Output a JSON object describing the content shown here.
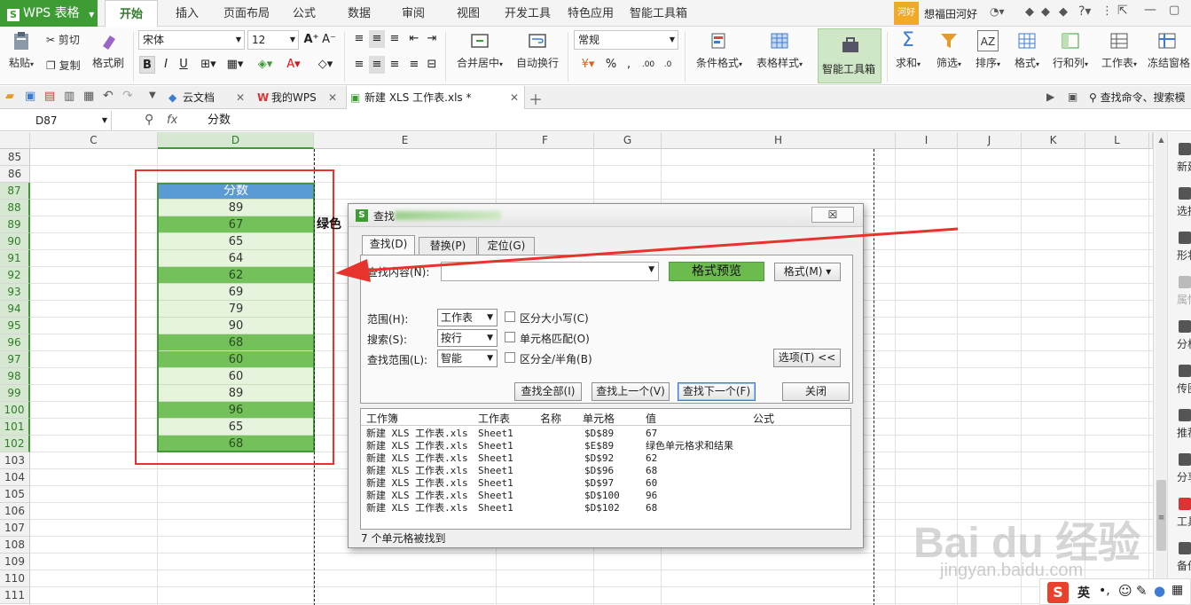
{
  "app": {
    "wps_label": "WPS 表格"
  },
  "menu": {
    "tabs": [
      "开始",
      "插入",
      "页面布局",
      "公式",
      "数据",
      "审阅",
      "视图",
      "开发工具",
      "特色应用",
      "智能工具箱"
    ],
    "active": "开始"
  },
  "user": {
    "avatar": "河好",
    "name": "想福田河好"
  },
  "ribbon": {
    "paste": "粘贴",
    "cut": "剪切",
    "copy": "复制",
    "format_painter": "格式刷",
    "font_name": "宋体",
    "font_size": "12",
    "bold": "B",
    "italic": "I",
    "underline": "U",
    "merge_center": "合并居中",
    "wrap_text": "自动换行",
    "number_format": "常规",
    "percent": "%",
    "comma": "‚",
    "cond_format": "条件格式",
    "table_style": "表格样式",
    "smart_toolbox": "智能工具箱",
    "sum": "求和",
    "filter": "筛选",
    "sort": "排序",
    "format": "格式",
    "row_col": "行和列",
    "worksheet": "工作表",
    "freeze": "冻结窗格"
  },
  "doc_tabs": {
    "cloud": "云文档",
    "mywps": "我的WPS",
    "file": "新建 XLS 工作表.xls *",
    "search_cmd": "查找命令、搜索模"
  },
  "formula_bar": {
    "cell_ref": "D87",
    "fx": "fx",
    "content": "分数"
  },
  "grid": {
    "columns": [
      "C",
      "D",
      "E",
      "F",
      "G",
      "H",
      "I",
      "J",
      "K",
      "L"
    ],
    "selected_column": "D",
    "rows": [
      "85",
      "86",
      "87",
      "88",
      "89",
      "90",
      "91",
      "92",
      "93",
      "94",
      "95",
      "96",
      "97",
      "98",
      "99",
      "100",
      "101",
      "102",
      "103",
      "104",
      "105",
      "106",
      "107",
      "108",
      "109",
      "110",
      "111"
    ],
    "header_label": "分数",
    "scores": [
      {
        "v": "89",
        "style": "light"
      },
      {
        "v": "67",
        "style": "dark"
      },
      {
        "v": "65",
        "style": "light"
      },
      {
        "v": "64",
        "style": "light"
      },
      {
        "v": "62",
        "style": "dark"
      },
      {
        "v": "69",
        "style": "light"
      },
      {
        "v": "79",
        "style": "light"
      },
      {
        "v": "90",
        "style": "light"
      },
      {
        "v": "68",
        "style": "dark"
      },
      {
        "v": "60",
        "style": "dark"
      },
      {
        "v": "60",
        "style": "light"
      },
      {
        "v": "89",
        "style": "light"
      },
      {
        "v": "96",
        "style": "dark"
      },
      {
        "v": "65",
        "style": "light"
      },
      {
        "v": "68",
        "style": "dark"
      }
    ],
    "overflow_text": "绿色"
  },
  "dialog": {
    "title": "查找",
    "close": "☒",
    "tabs": [
      "查找(D)",
      "替换(P)",
      "定位(G)"
    ],
    "find_label": "查找内容(N):",
    "format_preview": "格式预览",
    "format_btn": "格式(M) ▾",
    "scope_label": "范围(H):",
    "scope_value": "工作表",
    "search_label": "搜索(S):",
    "search_value": "按行",
    "lookin_label": "查找范围(L):",
    "lookin_value": "智能",
    "match_case": "区分大小写(C)",
    "match_cell": "单元格匹配(O)",
    "match_width": "区分全/半角(B)",
    "options_btn": "选项(T) <<",
    "find_all": "查找全部(I)",
    "find_prev": "查找上一个(V)",
    "find_next": "查找下一个(F)",
    "close_btn": "关闭",
    "columns": [
      "工作簿",
      "工作表",
      "名称",
      "单元格",
      "值",
      "公式"
    ],
    "results": [
      {
        "book": "新建 XLS 工作表.xls",
        "sheet": "Sheet1",
        "cell": "$D$89",
        "value": "67"
      },
      {
        "book": "新建 XLS 工作表.xls",
        "sheet": "Sheet1",
        "cell": "$E$89",
        "value": "绿色单元格求和结果"
      },
      {
        "book": "新建 XLS 工作表.xls",
        "sheet": "Sheet1",
        "cell": "$D$92",
        "value": "62"
      },
      {
        "book": "新建 XLS 工作表.xls",
        "sheet": "Sheet1",
        "cell": "$D$96",
        "value": "68"
      },
      {
        "book": "新建 XLS 工作表.xls",
        "sheet": "Sheet1",
        "cell": "$D$97",
        "value": "60"
      },
      {
        "book": "新建 XLS 工作表.xls",
        "sheet": "Sheet1",
        "cell": "$D$100",
        "value": "96"
      },
      {
        "book": "新建 XLS 工作表.xls",
        "sheet": "Sheet1",
        "cell": "$D$102",
        "value": "68"
      }
    ],
    "status": "7 个单元格被找到"
  },
  "right_panel": {
    "items": [
      "新建",
      "选择",
      "形状",
      "属性",
      "分析",
      "传图",
      "推荐",
      "分享",
      "工具",
      "备份"
    ]
  },
  "watermark": {
    "brand": "Bai du 经验",
    "url": "jingyan.baidu.com"
  },
  "ime": {
    "logo": "S",
    "mode": "英"
  },
  "colors": {
    "accent": "#3d9c34",
    "header_blue": "#5a9bd5",
    "cell_dark": "#74c05a",
    "cell_light": "#e6f3dd",
    "annotation_red": "#e8322c"
  }
}
